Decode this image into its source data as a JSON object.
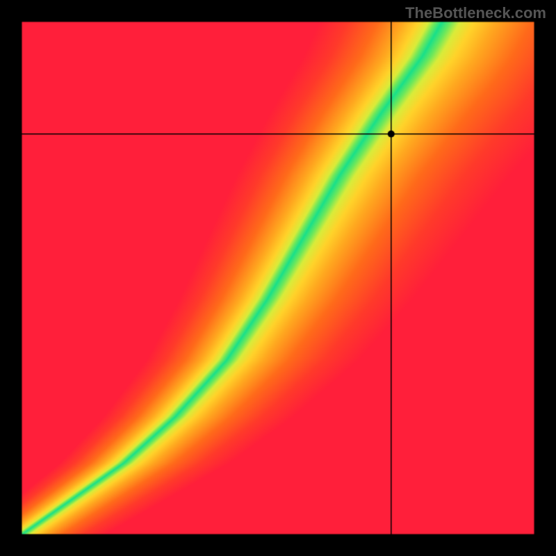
{
  "watermark": "TheBottleneck.com",
  "chart_data": {
    "type": "heatmap",
    "title": "",
    "xlabel": "",
    "ylabel": "",
    "xlim": [
      0,
      1
    ],
    "ylim": [
      0,
      1
    ],
    "colormap_description": "red→orange→yellow→green→yellow→orange→red along distance from optimal curve",
    "crosshair": {
      "x": 0.72,
      "y": 0.78
    },
    "marker": {
      "x": 0.72,
      "y": 0.78,
      "color": "#000000",
      "radius": 5
    },
    "optimal_curve": {
      "description": "monotone increasing curve from bottom-left to upper-middle; locus of peak (green) values",
      "points": [
        [
          0.0,
          0.0
        ],
        [
          0.1,
          0.07
        ],
        [
          0.2,
          0.14
        ],
        [
          0.3,
          0.23
        ],
        [
          0.4,
          0.34
        ],
        [
          0.48,
          0.46
        ],
        [
          0.55,
          0.58
        ],
        [
          0.62,
          0.7
        ],
        [
          0.7,
          0.82
        ],
        [
          0.78,
          0.93
        ],
        [
          0.82,
          1.0
        ]
      ]
    },
    "color_stops": [
      {
        "d": 0.0,
        "color": "#18e08a"
      },
      {
        "d": 0.05,
        "color": "#6ce85c"
      },
      {
        "d": 0.1,
        "color": "#d9ec3a"
      },
      {
        "d": 0.18,
        "color": "#ffd32a"
      },
      {
        "d": 0.3,
        "color": "#ffa81f"
      },
      {
        "d": 0.5,
        "color": "#ff6a1a"
      },
      {
        "d": 0.75,
        "color": "#ff3a2a"
      },
      {
        "d": 1.0,
        "color": "#ff1f3a"
      }
    ],
    "band_halfwidth_base": 0.035,
    "band_halfwidth_growth": 0.05
  }
}
